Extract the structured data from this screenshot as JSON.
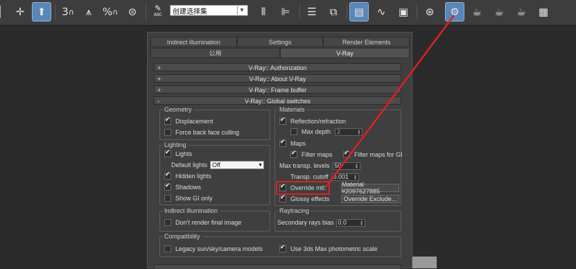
{
  "toolbar": {
    "material_select": "创建选择集",
    "icons": [
      "select-move",
      "select-region",
      "snap-3d",
      "angle-snap",
      "percent-snap",
      "spinner-snap",
      "edit-named-sets",
      "mirror",
      "align",
      "layer-manager",
      "ribbon",
      "curve-editor",
      "schematic-view",
      "material-editor",
      "render-setup",
      "rendered-frame",
      "render",
      "render-iterative",
      "render-active"
    ],
    "snap_label": "3",
    "percent_label": "%",
    "abc_label": "ABC"
  },
  "tabs_top": [
    "Indirect illumination",
    "Settings",
    "Render Elements"
  ],
  "tabs_bottom": [
    "公用",
    "V-Ray"
  ],
  "rollouts": [
    {
      "sign": "+",
      "label": "V-Ray:: Authorization"
    },
    {
      "sign": "+",
      "label": "V-Ray:: About V-Ray"
    },
    {
      "sign": "+",
      "label": "V-Ray:: Frame buffer"
    },
    {
      "sign": "-",
      "label": "V-Ray:: Global switches"
    }
  ],
  "geometry": {
    "title": "Geometry",
    "displacement": "Displacement",
    "force_back_face": "Force back face culling"
  },
  "lighting": {
    "title": "Lighting",
    "lights": "Lights",
    "default_lights_label": "Default lights",
    "default_lights_value": "Off",
    "hidden_lights": "Hidden lights",
    "shadows": "Shadows",
    "show_gi_only": "Show GI only"
  },
  "indirect": {
    "title": "Indirect illumination",
    "dont_render_final": "Don't render final image"
  },
  "materials": {
    "title": "Materials",
    "reflection_refraction": "Reflection/refraction",
    "max_depth_label": "Max depth",
    "max_depth_value": "2",
    "maps": "Maps",
    "filter_maps": "Filter maps",
    "filter_maps_gi": "Filter maps for GI",
    "max_transp_label": "Max transp. levels",
    "max_transp_value": "50",
    "transp_cutoff_label": "Transp. cutoff",
    "transp_cutoff_value": "0.001",
    "override_mtl": "Override mtl:",
    "override_mtl_value": "Material #2097627885",
    "glossy_effects": "Glossy effects",
    "override_exclude": "Override Exclude..."
  },
  "raytracing": {
    "title": "Raytracing",
    "secondary_bias_label": "Secondary rays bias",
    "secondary_bias_value": "0.0"
  },
  "compatibility": {
    "title": "Compatibility",
    "legacy": "Legacy sun/sky/camera models",
    "use_3ds": "Use 3ds Max photometric scale"
  },
  "annotation_color": "#e02020"
}
